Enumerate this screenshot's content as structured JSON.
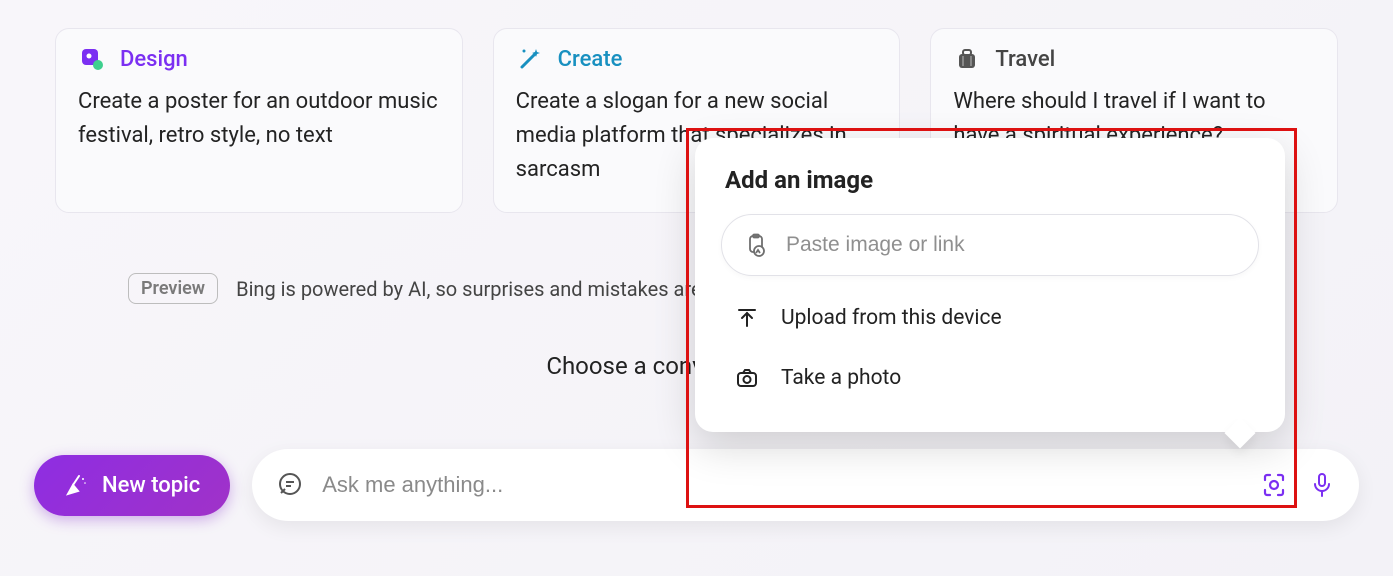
{
  "cards": [
    {
      "title": "Design",
      "body": "Create a poster for an outdoor music festival, retro style, no text"
    },
    {
      "title": "Create",
      "body": "Create a slogan for a new social media platform that specializes in sarcasm"
    },
    {
      "title": "Travel",
      "body": "Where should I travel if I want to have a spiritual experience?"
    }
  ],
  "preview": {
    "badge": "Preview",
    "text": "Bing is powered by AI, so surprises and mistakes are possible."
  },
  "choose_text": "Choose a conversation style",
  "new_topic_label": "New topic",
  "ask_placeholder": "Ask me anything...",
  "popup": {
    "title": "Add an image",
    "paste_placeholder": "Paste image or link",
    "upload_label": "Upload from this device",
    "photo_label": "Take a photo"
  }
}
